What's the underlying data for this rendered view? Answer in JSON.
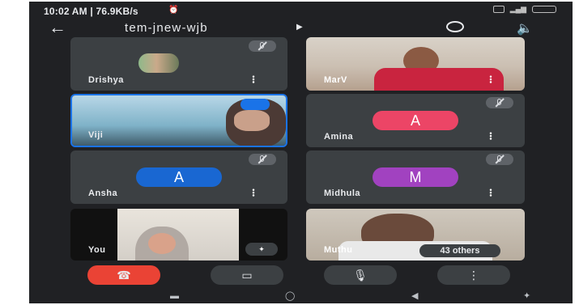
{
  "status_bar": {
    "time_text": "10:02 AM | 76.9KB/s",
    "right_icons": [
      "alarm-icon",
      "whatsapp-icon",
      "vowifi-icon",
      "signal-icon",
      "battery-icon"
    ]
  },
  "header": {
    "meeting_code": "tem-jnew-wjb",
    "icons": [
      "back-arrow-icon",
      "caret-right-icon",
      "switch-camera-icon",
      "speaker-icon"
    ]
  },
  "participants": [
    {
      "name": "Drishya",
      "video": "profile-photo",
      "muted": true
    },
    {
      "name": "MarV",
      "video": "camera",
      "muted": false
    },
    {
      "name": "Viji",
      "video": "camera",
      "speaking": true
    },
    {
      "name": "Amina",
      "avatar_letter": "A",
      "avatar_color": "#ec4566",
      "muted": true
    },
    {
      "name": "Ansha",
      "avatar_letter": "A",
      "avatar_color": "#1967d2",
      "muted": true
    },
    {
      "name": "Midhula",
      "avatar_letter": "M",
      "avatar_color": "#a142c0",
      "muted": true
    },
    {
      "name": "You",
      "video": "camera"
    },
    {
      "name": "Muthu",
      "video": "camera",
      "others_badge": "43 others"
    }
  ],
  "controls": {
    "icons": [
      "end-call-icon",
      "camera-icon",
      "microphone-icon",
      "more-options-icon"
    ]
  },
  "nav_bar": {
    "icons": [
      "recents-icon",
      "home-icon",
      "back-icon",
      "accessibility-icon"
    ]
  },
  "colors": {
    "background": "#202124",
    "tile": "#3c4043",
    "end_call": "#ea4335",
    "active_speaker_border": "#1a73e8"
  }
}
